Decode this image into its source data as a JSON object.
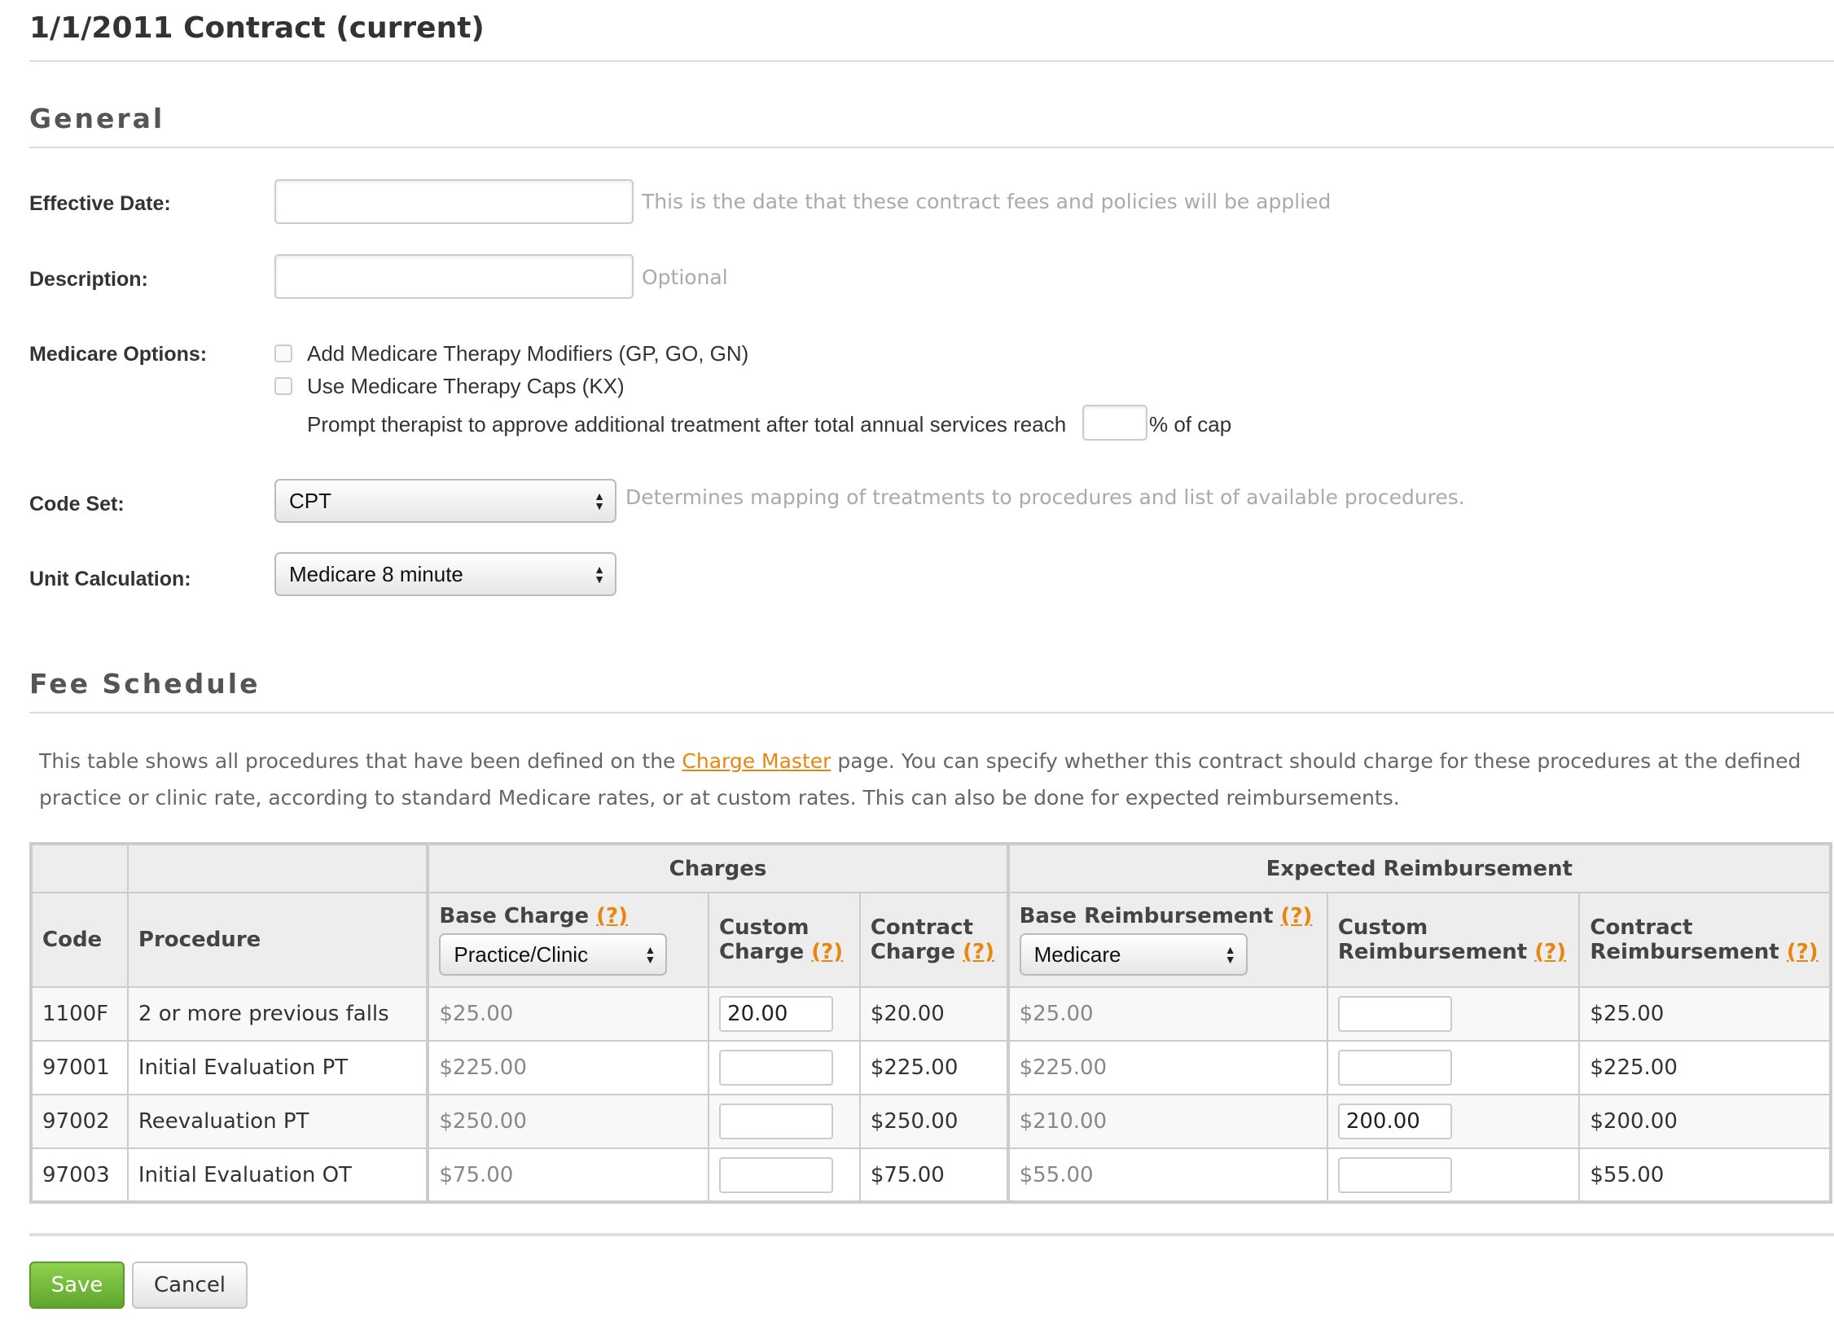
{
  "page": {
    "title": "1/1/2011 Contract (current)"
  },
  "general": {
    "heading": "General",
    "effective_date": {
      "label": "Effective Date:",
      "value": "",
      "hint": "This is the date that these contract fees and policies will be applied"
    },
    "description": {
      "label": "Description:",
      "value": "",
      "hint": "Optional"
    },
    "medicare_options": {
      "label": "Medicare Options:",
      "option1": {
        "label": "Add Medicare Therapy Modifiers (GP, GO, GN)",
        "checked": false
      },
      "option2": {
        "label": "Use Medicare Therapy Caps (KX)",
        "checked": false
      },
      "prompt_text": "Prompt therapist to approve additional treatment after total annual services reach",
      "prompt_value": "",
      "prompt_suffix": "% of cap"
    },
    "code_set": {
      "label": "Code Set:",
      "value": "CPT",
      "hint": "Determines mapping of treatments to procedures and list of available procedures."
    },
    "unit_calculation": {
      "label": "Unit Calculation:",
      "value": "Medicare 8 minute"
    }
  },
  "fee_schedule": {
    "heading": "Fee Schedule",
    "intro_before": "This table shows all procedures that have been defined on the ",
    "intro_link": "Charge Master",
    "intro_after": " page. You can specify whether this contract should charge for these procedures at the defined practice or clinic rate, according to standard Medicare rates, or at custom rates. This can also be done for expected reimbursements.",
    "group_charges": "Charges",
    "group_reimbursement": "Expected Reimbursement",
    "help": "(?)",
    "columns": {
      "code": "Code",
      "procedure": "Procedure",
      "base_charge": "Base Charge",
      "base_charge_select": "Practice/Clinic",
      "custom_charge_1": "Custom",
      "custom_charge_2": "Charge",
      "contract_charge_1": "Contract",
      "contract_charge_2": "Charge",
      "base_reimb": "Base Reimbursement",
      "base_reimb_select": "Medicare",
      "custom_reimb_1": "Custom",
      "custom_reimb_2": "Reimbursement",
      "contract_reimb_1": "Contract",
      "contract_reimb_2": "Reimbursement"
    },
    "rows": [
      {
        "code": "1100F",
        "procedure": "2 or more previous falls",
        "base_charge": "$25.00",
        "custom_charge": "20.00",
        "contract_charge": "$20.00",
        "base_reimb": "$25.00",
        "custom_reimb": "",
        "contract_reimb": "$25.00"
      },
      {
        "code": "97001",
        "procedure": "Initial Evaluation PT",
        "base_charge": "$225.00",
        "custom_charge": "",
        "contract_charge": "$225.00",
        "base_reimb": "$225.00",
        "custom_reimb": "",
        "contract_reimb": "$225.00"
      },
      {
        "code": "97002",
        "procedure": "Reevaluation PT",
        "base_charge": "$250.00",
        "custom_charge": "",
        "contract_charge": "$250.00",
        "base_reimb": "$210.00",
        "custom_reimb": "200.00",
        "contract_reimb": "$200.00"
      },
      {
        "code": "97003",
        "procedure": "Initial Evaluation OT",
        "base_charge": "$75.00",
        "custom_charge": "",
        "contract_charge": "$75.00",
        "base_reimb": "$55.00",
        "custom_reimb": "",
        "contract_reimb": "$55.00"
      }
    ]
  },
  "actions": {
    "save": "Save",
    "cancel": "Cancel"
  },
  "colors": {
    "link": "#e8860f",
    "save_button": "#6cb535",
    "muted_text": "#888888"
  }
}
